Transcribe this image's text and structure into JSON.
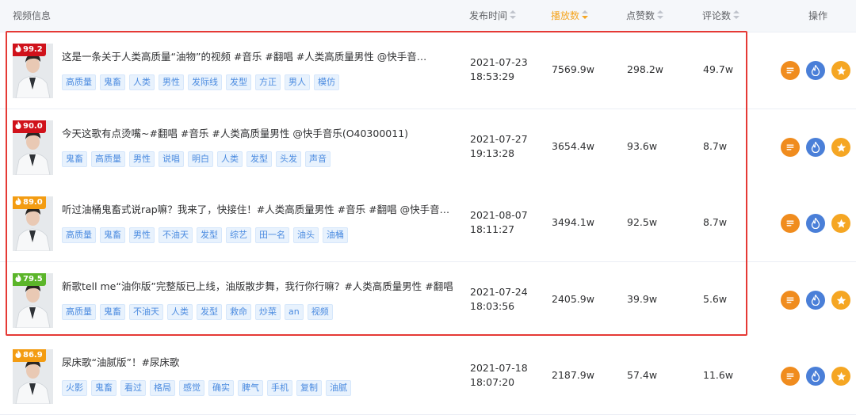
{
  "table": {
    "headers": {
      "video_info": "视频信息",
      "publish_time": "发布时间",
      "plays": "播放数",
      "likes": "点赞数",
      "comments": "评论数",
      "actions": "操作"
    },
    "active_sort_column": "plays",
    "colors": {
      "accent": "#f5a623",
      "highlight_border": "#e53935",
      "tag_text": "#4b8be0",
      "tag_bg": "#e8f2fd"
    },
    "rows": [
      {
        "score": "99.2",
        "score_color": "#d0121b",
        "title": "这是一条关于人类高质量“油物”的视频 #音乐 #翻唱 #人类高质量男性 @快手音…",
        "tags": [
          "高质量",
          "鬼畜",
          "人类",
          "男性",
          "发际线",
          "发型",
          "方正",
          "男人",
          "模仿"
        ],
        "date": "2021-07-23",
        "time": "18:53:29",
        "plays": "7569.9w",
        "likes": "298.2w",
        "comments": "49.7w"
      },
      {
        "score": "90.0",
        "score_color": "#d0121b",
        "title": "今天这歌有点烫嘴~#翻唱 #音乐 #人类高质量男性 @快手音乐(O40300011)",
        "tags": [
          "鬼畜",
          "高质量",
          "男性",
          "说唱",
          "明白",
          "人类",
          "发型",
          "头发",
          "声音"
        ],
        "date": "2021-07-27",
        "time": "19:13:28",
        "plays": "3654.4w",
        "likes": "93.6w",
        "comments": "8.7w"
      },
      {
        "score": "89.0",
        "score_color": "#f39c12",
        "title": "听过油桶鬼畜式说rap嘛？我来了，快接住！#人类高质量男性 #音乐 #翻唱 @快手音…",
        "tags": [
          "高质量",
          "鬼畜",
          "男性",
          "不油天",
          "发型",
          "综艺",
          "田一名",
          "油头",
          "油桶"
        ],
        "date": "2021-08-07",
        "time": "18:11:27",
        "plays": "3494.1w",
        "likes": "92.5w",
        "comments": "8.7w"
      },
      {
        "score": "79.5",
        "score_color": "#5bb52a",
        "title": "新歌tell me“油你版”完整版已上线，油版散步舞，我行你行嘛？#人类高质量男性 #翻唱 #…",
        "tags": [
          "高质量",
          "鬼畜",
          "不油天",
          "人类",
          "发型",
          "救命",
          "炒菜",
          "an",
          "视频"
        ],
        "date": "2021-07-24",
        "time": "18:03:56",
        "plays": "2405.9w",
        "likes": "39.9w",
        "comments": "5.6w"
      },
      {
        "score": "86.9",
        "score_color": "#f39c12",
        "title": "尿床歌“油腻版”！#尿床歌",
        "tags": [
          "火影",
          "鬼畜",
          "看过",
          "格局",
          "感觉",
          "确实",
          "脾气",
          "手机",
          "复制",
          "油腻"
        ],
        "date": "2021-07-18",
        "time": "18:07:20",
        "plays": "2187.9w",
        "likes": "57.4w",
        "comments": "11.6w"
      }
    ],
    "action_icons": [
      {
        "name": "detail-list-icon",
        "color": "#f08c1e"
      },
      {
        "name": "hot-flame-icon",
        "color": "#4a7fd8"
      },
      {
        "name": "favorite-star-icon",
        "color": "#f5a623"
      }
    ]
  }
}
